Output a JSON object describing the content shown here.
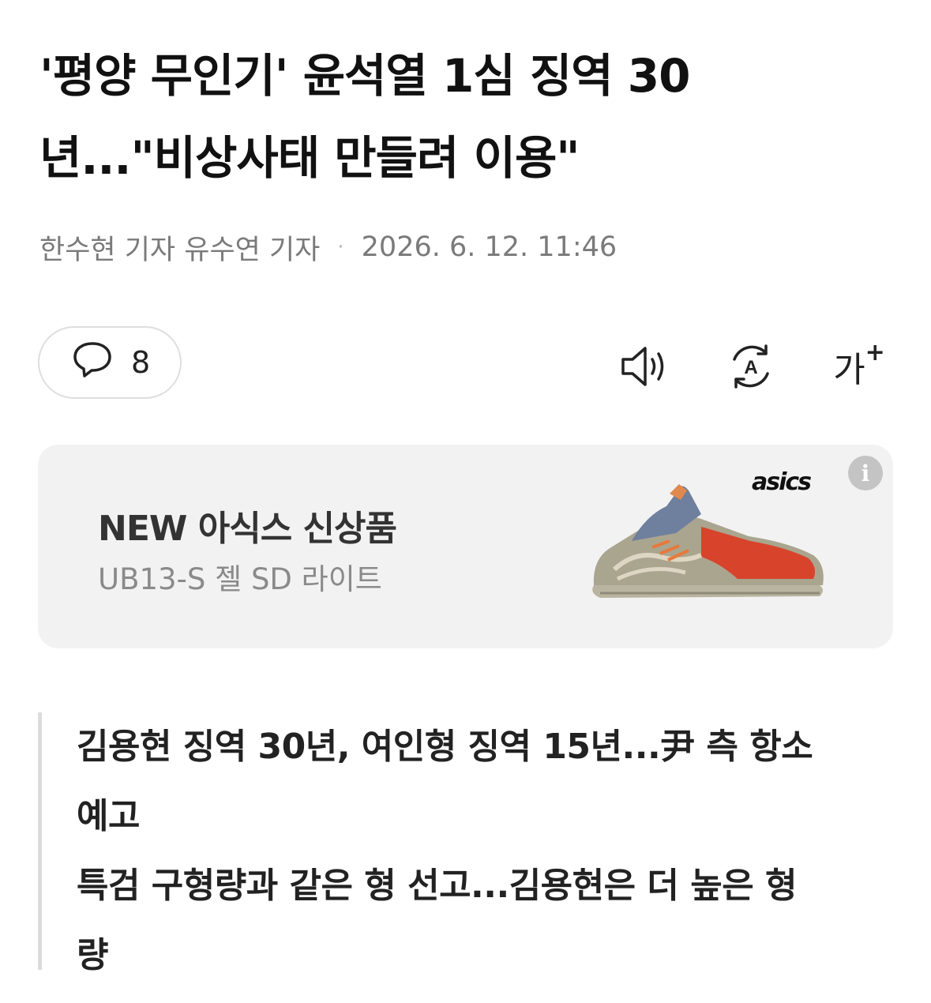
{
  "article": {
    "headline_line1": "'평양 무인기' 윤석열 1심 징역 30",
    "headline_line2": "년...\"비상사태 만들려 이용\"",
    "reporters": "한수현 기자 유수연 기자",
    "separator": "·",
    "datetime": "2026. 6. 12. 11:46"
  },
  "toolbar": {
    "comment_count": "8",
    "comment_icon": "speech-bubble-icon",
    "listen_icon": "speaker-icon",
    "translate_icon": "translate-icon",
    "font_size_label": "가",
    "font_size_plus": "+"
  },
  "ad": {
    "title": "NEW 아식스 신상품",
    "subtitle": "UB13-S 젤 SD 라이트",
    "brand": "asics",
    "info_label": "i"
  },
  "summary": {
    "line1": "김용현 징역 30년, 여인형 징역 15년...尹 측 항소",
    "line2": "예고",
    "line3": "특검 구형량과 같은 형 선고...김용현은 더 높은 형",
    "line4": "량"
  },
  "colors": {
    "text_primary": "#111111",
    "meta_gray": "#7a7a7a",
    "ad_background": "#f2f2f2",
    "quote_bar": "#dcdcdc",
    "border": "#dedede"
  }
}
